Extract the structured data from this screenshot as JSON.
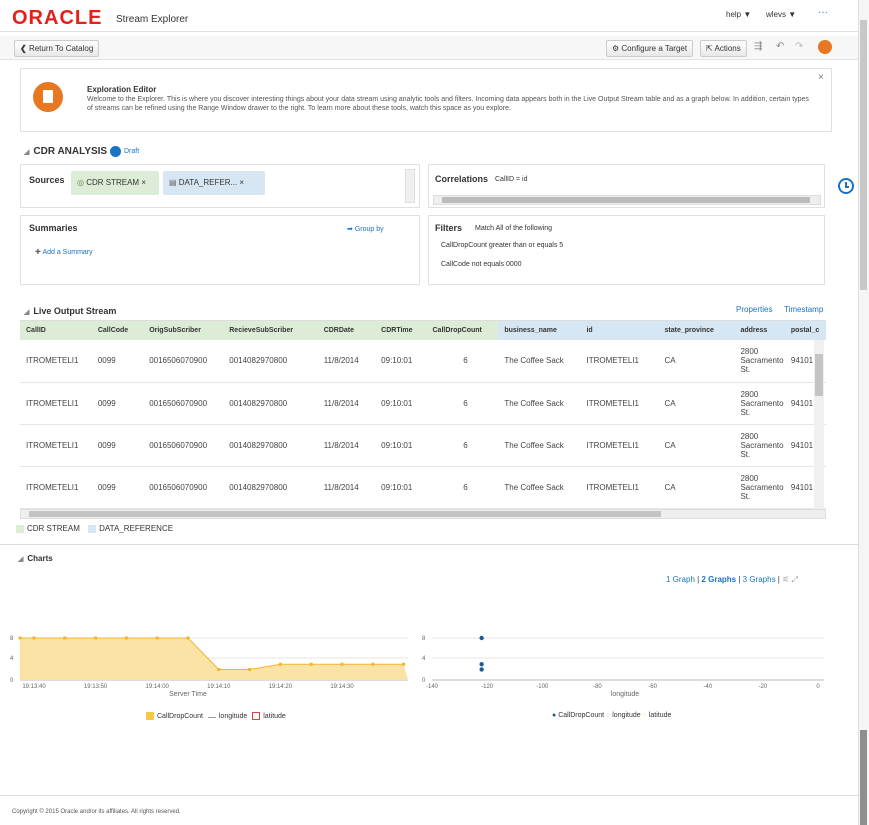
{
  "header": {
    "logo": "ORACLE",
    "app_name": "Stream Explorer",
    "help": "help ▼",
    "user": "wlevs ▼",
    "more": "···"
  },
  "toolbar": {
    "return": "Return To Catalog",
    "configure": "Configure a Target",
    "actions": "Actions"
  },
  "editor": {
    "title": "Exploration Editor",
    "text": "Welcome to the Explorer. This is where you discover interesting things about your data stream using analytic tools and filters. Incoming data appears both in the Live Output Stream table and as a graph below. In addition, certain types of streams can be refined using the Range Window drawer to the right. To learn more about these tools, watch this space as you explore.",
    "close": "×"
  },
  "analysis": {
    "title": "CDR ANALYSIS",
    "draft": "Draft"
  },
  "sources": {
    "label": "Sources",
    "chip1": "CDR STREAM ×",
    "chip2": "DATA_REFER... ×"
  },
  "correlations": {
    "label": "Correlations",
    "value": "CallID = id"
  },
  "summaries": {
    "label": "Summaries",
    "group_by": "Group by",
    "add": "Add a Summary"
  },
  "filters": {
    "label": "Filters",
    "match": "Match All of the following",
    "f1": "CallDropCount greater than or equals 5",
    "f2": "CallCode not equals 0000"
  },
  "output": {
    "title": "Live Output Stream",
    "properties": "Properties",
    "timestamp": "Timestamp",
    "columns": [
      "CallID",
      "CallCode",
      "OrigSubScriber",
      "RecieveSubScriber",
      "CDRDate",
      "CDRTime",
      "CallDropCount",
      "business_name",
      "id",
      "state_province",
      "address",
      "postal_c"
    ],
    "row": [
      "ITROMETELI1",
      "0099",
      "0016506070900",
      "0014082970800",
      "11/8/2014",
      "09:10:01",
      "6",
      "The Coffee Sack",
      "ITROMETELI1",
      "CA",
      "2800 Sacramento St.",
      "94101"
    ],
    "legend1": "CDR STREAM",
    "legend2": "DATA_REFERENCE"
  },
  "charts": {
    "title": "Charts",
    "g1": "1 Graph",
    "g2": "2 Graphs",
    "g3": "3 Graphs",
    "left_x_label": "Server Time",
    "left_ticks": [
      "19:13:40",
      "19:13:50",
      "19:14:00",
      "19:14:10",
      "19:14:20",
      "19:14:30"
    ],
    "right_x_label": "longitude",
    "right_ticks": [
      "-140",
      "-120",
      "-100",
      "-80",
      "-60",
      "-40",
      "-20",
      "0"
    ],
    "y_ticks": [
      "8",
      "4",
      "0"
    ],
    "legend": {
      "a": "CallDropCount",
      "b": "longitude",
      "c": "latitude"
    }
  },
  "chart_data": [
    {
      "type": "area",
      "xlabel": "Server Time",
      "ylim": [
        0,
        8
      ],
      "categories": [
        "19:13:40",
        "19:13:50",
        "19:14:00",
        "19:14:10",
        "19:14:20",
        "19:14:30"
      ],
      "series": [
        {
          "name": "CallDropCount",
          "x": [
            -5,
            0,
            5,
            10,
            15,
            20,
            25,
            30,
            35,
            40,
            45,
            50,
            55,
            60
          ],
          "values": [
            8,
            8,
            8,
            8,
            8,
            8,
            8,
            2,
            2,
            3,
            3,
            3,
            3,
            3
          ]
        }
      ]
    },
    {
      "type": "scatter",
      "xlabel": "longitude",
      "ylim": [
        0,
        8
      ],
      "xlim": [
        -140,
        0
      ],
      "series": [
        {
          "name": "CallDropCount",
          "x": [
            -122,
            -122,
            -122
          ],
          "values": [
            8,
            3,
            2
          ]
        }
      ]
    }
  ],
  "footer": "Copyright © 2015 Oracle and/or its affiliates. All rights reserved."
}
